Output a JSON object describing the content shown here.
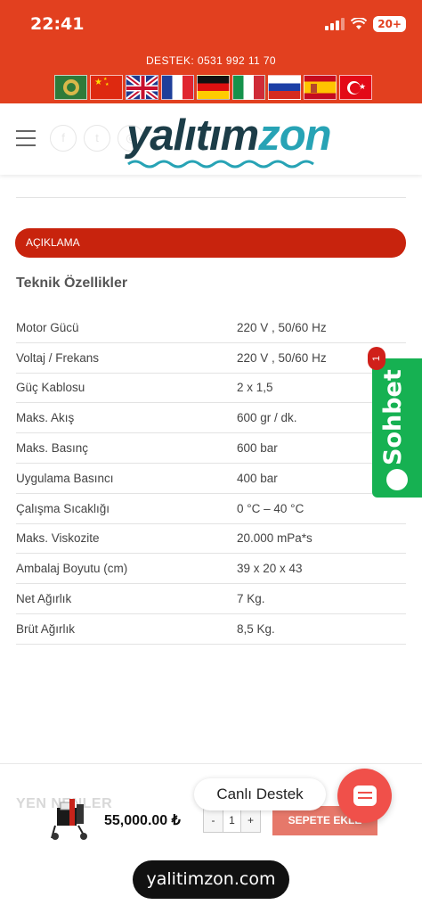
{
  "status_bar": {
    "time": "22:41",
    "battery": "20+"
  },
  "header": {
    "support_text": "DESTEK: 0531 992 11 70",
    "language_flags": [
      "arabic-flag",
      "china-flag",
      "uk-flag",
      "france-flag",
      "germany-flag",
      "italy-flag",
      "russia-flag",
      "spain-flag",
      "turkey-flag"
    ],
    "brand_color": "#e2401f"
  },
  "logo": {
    "part1": "yalıtım",
    "part2": "zon"
  },
  "description_tab": {
    "label": "AÇIKLAMA"
  },
  "specs": {
    "title": "Teknik Özellikler",
    "rows": [
      {
        "key": "Motor Gücü",
        "value": "220 V , 50/60 Hz"
      },
      {
        "key": "Voltaj / Frekans",
        "value": "220 V , 50/60 Hz"
      },
      {
        "key": "Güç Kablosu",
        "value": "2 x 1,5"
      },
      {
        "key": "Maks. Akış",
        "value": "600 gr / dk."
      },
      {
        "key": "Maks. Basınç",
        "value": "600 bar"
      },
      {
        "key": "Uygulama Basıncı",
        "value": "400 bar"
      },
      {
        "key": "Çalışma Sıcaklığı",
        "value": "0 °C – 40 °C"
      },
      {
        "key": "Maks. Viskozite",
        "value": "20.000 mPa*s"
      },
      {
        "key": "Ambalaj Boyutu (cm)",
        "value": "39 x 20 x 43"
      },
      {
        "key": "Net Ağırlık",
        "value": "7 Kg."
      },
      {
        "key": "Brüt Ağırlık",
        "value": "8,5 Kg."
      }
    ]
  },
  "sohbet": {
    "label": "Sohbet",
    "badge": "1",
    "color": "#16b152"
  },
  "bottom": {
    "ghost_heading": "YEN       NENLER",
    "price": "55,000.00 ₺",
    "qty_minus": "-",
    "qty_value": "1",
    "qty_plus": "+",
    "add_to_cart": "SEPETE EKLE",
    "live_support": "Canlı Destek",
    "url": "yalitimzon.com"
  }
}
